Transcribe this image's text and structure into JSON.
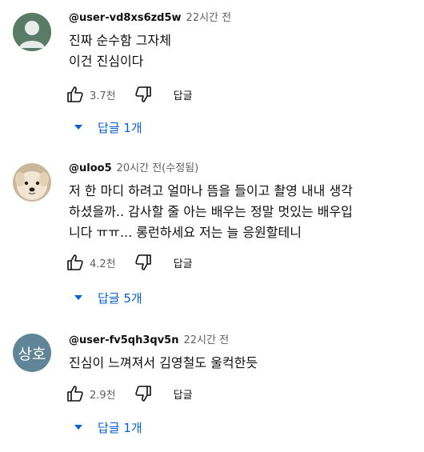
{
  "comments": [
    {
      "author": "@user-vd8xs6zd5w",
      "time": "22시간 전",
      "text": "진짜 순수함 그자체\n이건 진심이다",
      "likes": "3.7천",
      "reply_label": "답글",
      "replies_label": "답글 1개",
      "avatar": "default-avatar-icon"
    },
    {
      "author": "@uloo5",
      "time": "20시간 전(수정됨)",
      "text": "저 한 마디 하려고 얼마나 뜸을 들이고 촬영 내내 생각\n하셨을까.. 감사할 줄 아는 배우는 정말 멋있는 배우입\n니다 ㅠㅠ... 롱런하세요 저는 늘 응원할테니",
      "likes": "4.2천",
      "reply_label": "답글",
      "replies_label": "답글 5개",
      "avatar": "puppy-photo"
    },
    {
      "author": "@user-fv5qh3qv5n",
      "time": "22시간 전",
      "text": "진심이 느껴져서 김영철도 울컥한듯",
      "likes": "2.9천",
      "reply_label": "답글",
      "replies_label": "답글 1개",
      "avatar_text": "상호"
    }
  ],
  "colors": {
    "link": "#065fd4",
    "secondary": "#606060",
    "avatar3": "#5f8596"
  }
}
